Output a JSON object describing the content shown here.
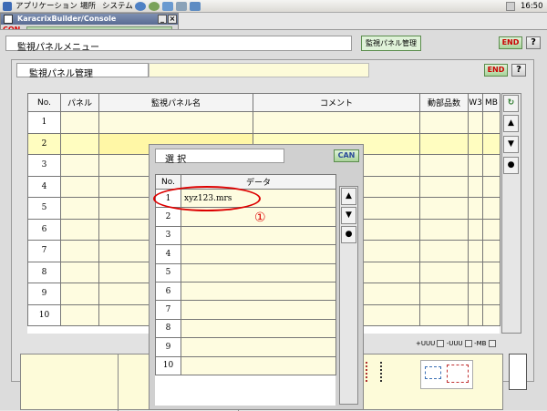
{
  "topbar": {
    "applications": "アプリケーション",
    "places": "場所",
    "system": "システム",
    "clock": "16:50"
  },
  "console": {
    "title": "KaracrixBuilder/Console",
    "con_label": "CON"
  },
  "app": {
    "menu_title": "監視パネルメニュー",
    "active_mode": "監視パネル管理",
    "end_label": "END",
    "help_label": "?"
  },
  "panel": {
    "title": "監視パネル管理",
    "end_label": "END",
    "help_label": "?",
    "columns": [
      "No.",
      "パネル",
      "監視パネル名",
      "コメント",
      "動部品数",
      "W3",
      "MB"
    ],
    "rows": [
      "1",
      "2",
      "3",
      "4",
      "5",
      "6",
      "7",
      "8",
      "9",
      "10"
    ],
    "selected_row": 2,
    "footer": [
      "+UUU",
      "-UUU",
      "-MB"
    ]
  },
  "popup": {
    "title": "選 択",
    "can_label": "CAN",
    "col_no": "No.",
    "col_data": "データ",
    "rows": [
      {
        "no": "1",
        "data": "xyz123.mrs"
      },
      {
        "no": "2",
        "data": ""
      },
      {
        "no": "3",
        "data": ""
      },
      {
        "no": "4",
        "data": ""
      },
      {
        "no": "5",
        "data": ""
      },
      {
        "no": "6",
        "data": ""
      },
      {
        "no": "7",
        "data": ""
      },
      {
        "no": "8",
        "data": ""
      },
      {
        "no": "9",
        "data": ""
      },
      {
        "no": "10",
        "data": ""
      }
    ],
    "annotation": "①"
  },
  "icons": {
    "up": "▲",
    "down": "▼",
    "dot": "●",
    "refresh": "↻"
  },
  "colors": {
    "accent_red": "#dd0000",
    "cell_yellow": "#fefce0",
    "selected_yellow": "#fff7a6"
  }
}
